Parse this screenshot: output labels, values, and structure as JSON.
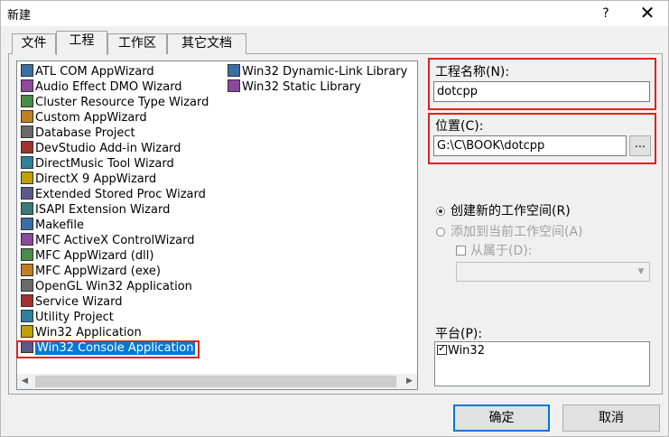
{
  "window": {
    "title": "新建",
    "help_label": "?",
    "close_label": "✕"
  },
  "tabs": [
    {
      "label": "文件"
    },
    {
      "label": "工程"
    },
    {
      "label": "工作区"
    },
    {
      "label": "其它文档"
    }
  ],
  "projects": {
    "column1": [
      "ATL COM AppWizard",
      "Audio Effect DMO Wizard",
      "Cluster Resource Type Wizard",
      "Custom AppWizard",
      "Database Project",
      "DevStudio Add-in Wizard",
      "DirectMusic Tool Wizard",
      "DirectX 9 AppWizard",
      "Extended Stored Proc Wizard",
      "ISAPI Extension Wizard",
      "Makefile",
      "MFC ActiveX ControlWizard",
      "MFC AppWizard (dll)",
      "MFC AppWizard (exe)",
      "OpenGL Win32 Application",
      "Service Wizard",
      "Utility Project",
      "Win32 Application",
      "Win32 Console Application"
    ],
    "column2": [
      "Win32 Dynamic-Link Library",
      "Win32 Static Library"
    ],
    "selected": "Win32 Console Application"
  },
  "project_name": {
    "label": "工程名称(N):",
    "value": "dotcpp"
  },
  "location": {
    "label": "位置(C):",
    "value": "G:\\C\\BOOK\\dotcpp",
    "browse_label": "..."
  },
  "workspace": {
    "create_new": "创建新的工作空间(R)",
    "add_to_current": "添加到当前工作空间(A)",
    "dependency": "从属于(D):"
  },
  "platform": {
    "label": "平台(P):",
    "items": [
      "Win32"
    ]
  },
  "buttons": {
    "ok": "确定",
    "cancel": "取消"
  },
  "colors": {
    "highlight_border": "#e02020",
    "selection": "#0078d7"
  }
}
